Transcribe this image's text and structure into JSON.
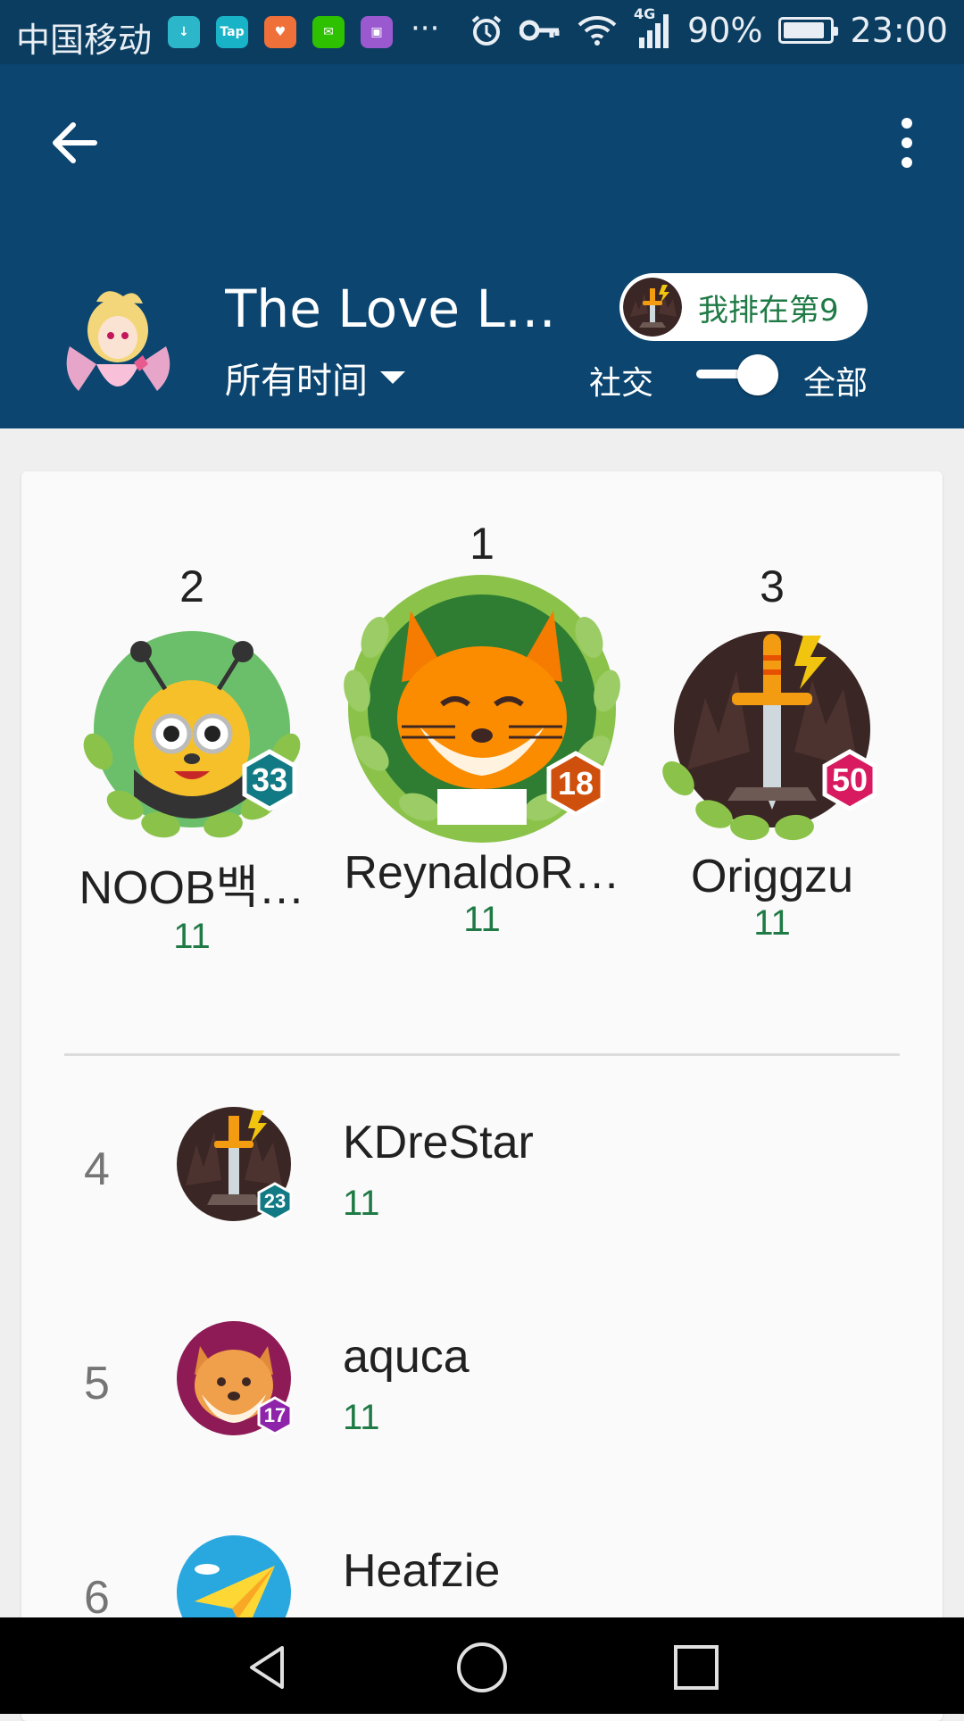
{
  "status_bar": {
    "carrier": "中国移动",
    "apps": [
      {
        "icon": "download-icon",
        "color": "#2bb7c9",
        "text": "↓"
      },
      {
        "icon": "taptap-icon",
        "color": "#19b3c7",
        "text": "Tap"
      },
      {
        "icon": "heart-app-icon",
        "color": "#f0703a",
        "text": "♥"
      },
      {
        "icon": "wechat-icon",
        "color": "#2dc100",
        "text": "✉"
      },
      {
        "icon": "gallery-icon",
        "color": "#9b59d0",
        "text": "▣"
      }
    ],
    "more": "···",
    "network": "4G",
    "battery": "90%",
    "battery_level": 0.9,
    "time": "23:00"
  },
  "header": {
    "game_title": "The Love Let…",
    "time_filter": "所有时间",
    "my_rank": "我排在第9",
    "toggle_left": "社交",
    "toggle_right": "全部",
    "colors": {
      "header_bg": "#0b4570",
      "status_bg": "#0b3d61",
      "accent_green": "#1f7a45"
    }
  },
  "podium": [
    {
      "rank": "2",
      "name": "NOOB백…",
      "score": "11",
      "level": "33",
      "badge_color": "#117a85",
      "avatar": "bee-avatar-icon"
    },
    {
      "rank": "1",
      "name": "ReynaldoR…",
      "score": "11",
      "level": "18",
      "badge_color": "#cf4f0c",
      "avatar": "fox-avatar-icon"
    },
    {
      "rank": "3",
      "name": "Origgzu",
      "score": "11",
      "level": "50",
      "badge_color": "#d81b60",
      "avatar": "sword-avatar-icon"
    }
  ],
  "rows": [
    {
      "rank": "4",
      "name": "KDreStar",
      "score": "11",
      "level": "23",
      "badge_color": "#117a85",
      "avatar": "sword-avatar-icon"
    },
    {
      "rank": "5",
      "name": "aquca",
      "score": "11",
      "level": "17",
      "badge_color": "#8e24aa",
      "avatar": "shiba-avatar-icon"
    },
    {
      "rank": "6",
      "name": "Heafzie",
      "score": "",
      "level": "",
      "badge_color": "#2e7d32",
      "avatar": "paper-plane-avatar-icon"
    }
  ]
}
